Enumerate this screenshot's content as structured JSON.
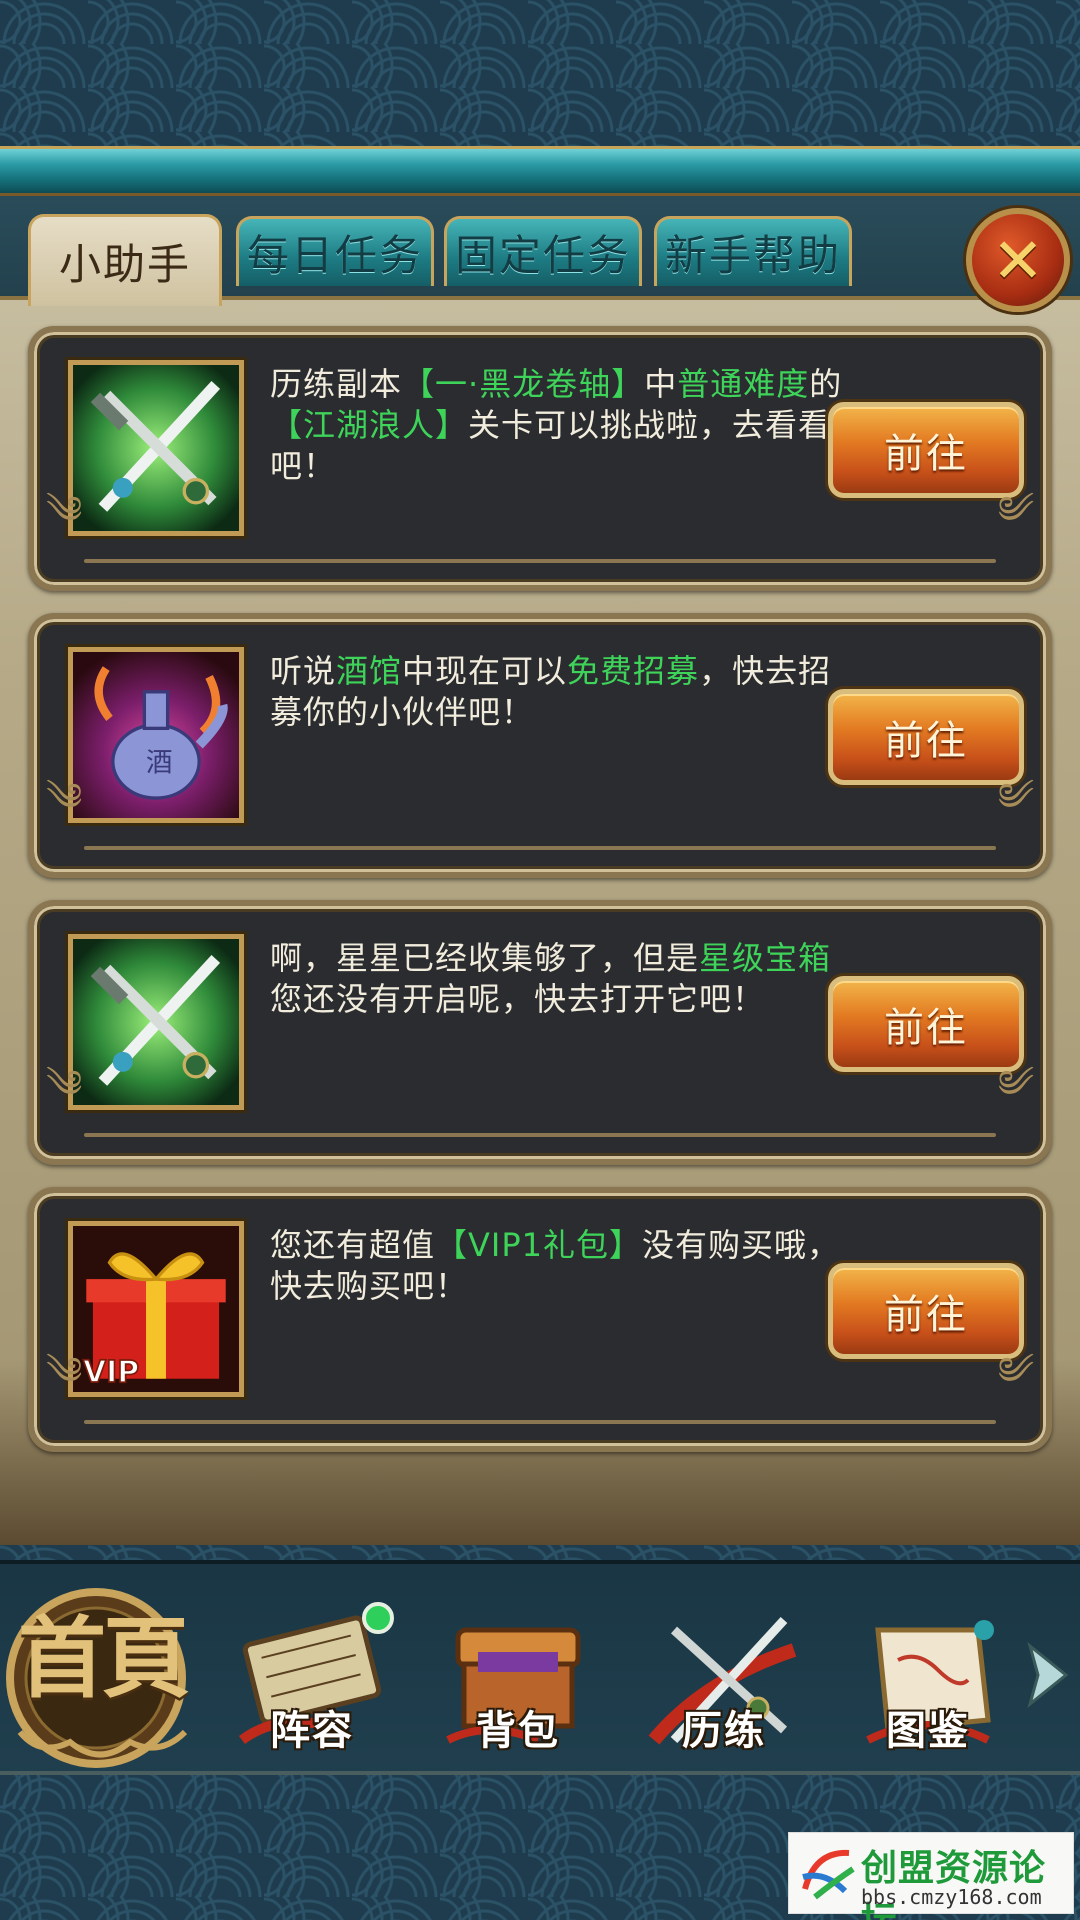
{
  "tabs": [
    {
      "label": "小助手",
      "active": true
    },
    {
      "label": "每日任务",
      "active": false
    },
    {
      "label": "固定任务",
      "active": false
    },
    {
      "label": "新手帮助",
      "active": false
    }
  ],
  "close_icon": "close-x-icon",
  "cards": [
    {
      "icon": "crossed-swords-icon",
      "text_parts": [
        {
          "text": "历练副本",
          "hl": false
        },
        {
          "text": "【一·黑龙卷轴】",
          "hl": true
        },
        {
          "text": "中",
          "hl": false
        },
        {
          "text": "普通难度",
          "hl": true
        },
        {
          "text": "的",
          "hl": false
        },
        {
          "text": "【江湖浪人】",
          "hl": true
        },
        {
          "text": "关卡可以挑战啦，去看看吧！",
          "hl": false
        }
      ],
      "button_label": "前往"
    },
    {
      "icon": "wine-pot-icon",
      "text_parts": [
        {
          "text": "听说",
          "hl": false
        },
        {
          "text": "酒馆",
          "hl": true
        },
        {
          "text": "中现在可以",
          "hl": false
        },
        {
          "text": "免费招募",
          "hl": true
        },
        {
          "text": "，快去招募你的小伙伴吧！",
          "hl": false
        }
      ],
      "button_label": "前往"
    },
    {
      "icon": "crossed-swords-icon",
      "text_parts": [
        {
          "text": "啊，星星已经收集够了，但是",
          "hl": false
        },
        {
          "text": "星级宝箱",
          "hl": true
        },
        {
          "text": "您还没有开启呢，快去打开它吧！",
          "hl": false
        }
      ],
      "button_label": "前往"
    },
    {
      "icon": "vip-gift-icon",
      "text_parts": [
        {
          "text": "您还有超值",
          "hl": false
        },
        {
          "text": "【VIP1礼包】",
          "hl": true
        },
        {
          "text": "没有购买哦，快去购买吧！",
          "hl": false
        }
      ],
      "button_label": "前往",
      "icon_badge": "VIP"
    }
  ],
  "nav": {
    "home_label": "首頁",
    "items": [
      {
        "label": "阵容",
        "icon": "formation-board-icon"
      },
      {
        "label": "背包",
        "icon": "treasure-chest-icon"
      },
      {
        "label": "历练",
        "icon": "crossed-swords-icon"
      },
      {
        "label": "图鉴",
        "icon": "scroll-icon"
      }
    ],
    "more_icon": "arrow-right-icon"
  },
  "watermark": {
    "title": "创盟资源论坛",
    "url": "bbs.cmzy168.com"
  },
  "colors": {
    "highlight": "#3ed45a",
    "button": "#e37b22",
    "panel": "#2a2c30",
    "tab_active": "#e6ddc6",
    "tab_inactive": "#1d7b83"
  }
}
